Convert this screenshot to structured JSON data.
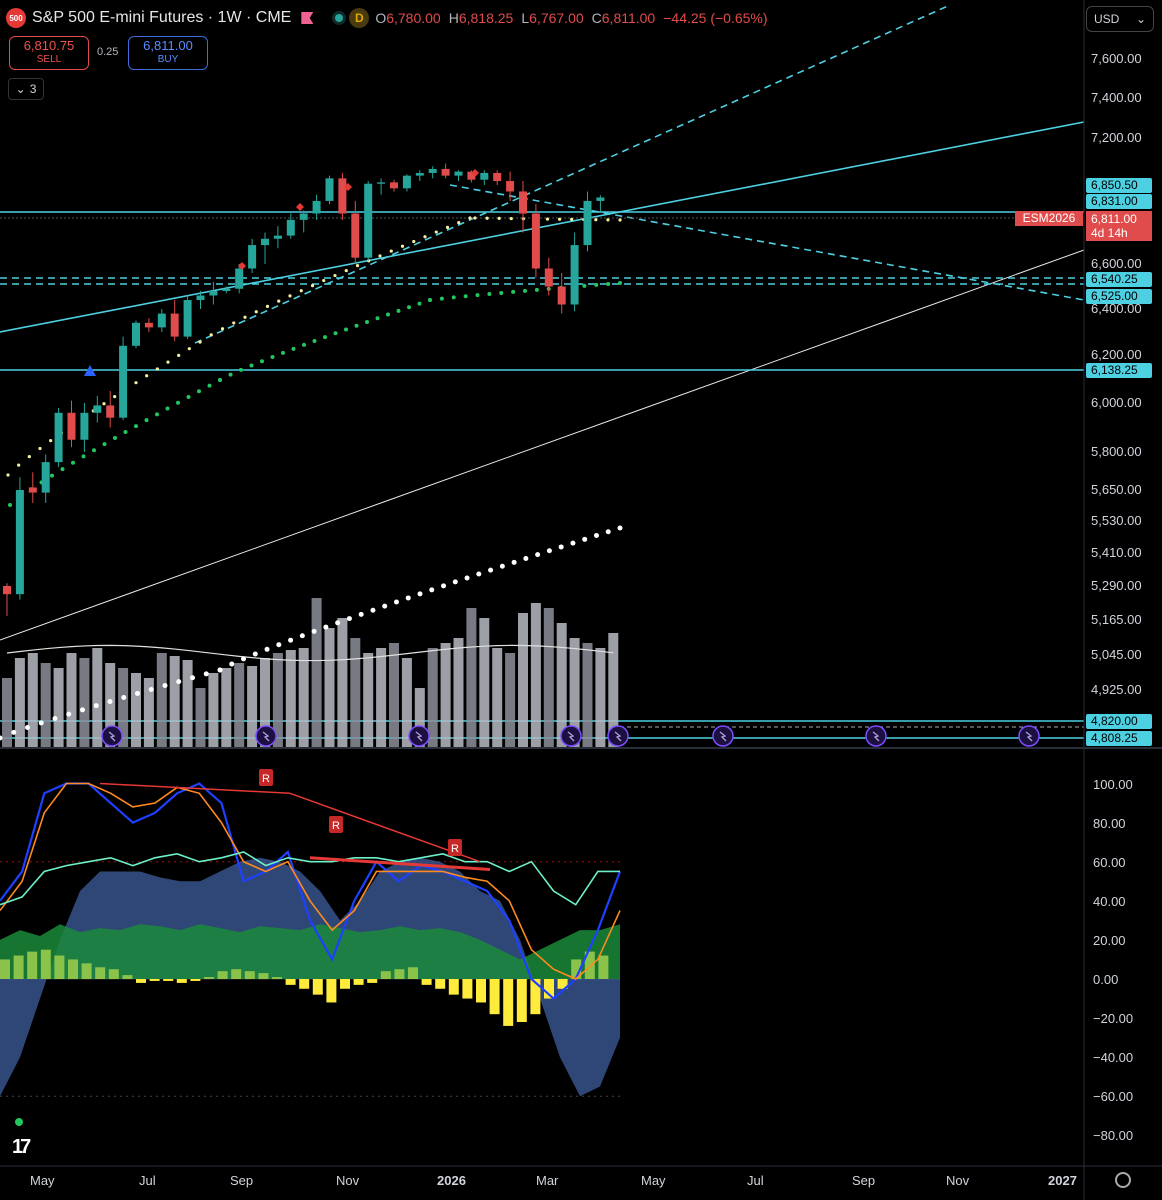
{
  "header": {
    "logo_text": "500",
    "symbol_title": "S&P 500 E-mini Futures · 1W · CME",
    "interval_badge": "D",
    "ohlc": {
      "open_label": "O",
      "open": "6,780.00",
      "high_label": "H",
      "high": "6,818.25",
      "low_label": "L",
      "low": "6,767.00",
      "close_label": "C",
      "close": "6,811.00",
      "change": "−44.25 (−0.65%)"
    },
    "colors": {
      "down": "#e04b4b",
      "up": "#26a69a",
      "accent": "#4dd0e1"
    }
  },
  "trade": {
    "sell_price": "6,810.75",
    "sell_label": "SELL",
    "spread": "0.25",
    "buy_price": "6,811.00",
    "buy_label": "BUY"
  },
  "layers": {
    "icon": "chevron-down-icon",
    "count": "3"
  },
  "currency": {
    "label": "USD",
    "icon": "chevron-down-icon"
  },
  "price_axis": [
    "7,600.00",
    "7,400.00",
    "7,200.00",
    "6,600.00",
    "6,400.00",
    "6,200.00",
    "6,000.00",
    "5,800.00",
    "5,650.00",
    "5,530.00",
    "5,410.00",
    "5,290.00",
    "5,165.00",
    "5,045.00",
    "4,925.00"
  ],
  "price_tags": [
    "6,850.50",
    "6,831.00",
    "6,540.25",
    "6,525.00",
    "6,138.25",
    "4,820.00",
    "4,808.25"
  ],
  "current": {
    "symbol": "ESM2026",
    "price": "6,811.00",
    "countdown": "4d 14h"
  },
  "oscillator_axis": [
    "100.00",
    "80.00",
    "60.00",
    "40.00",
    "20.00",
    "0.00",
    "−20.00",
    "−40.00",
    "−60.00",
    "−80.00"
  ],
  "oscillator_markers": {
    "reversal": "R"
  },
  "time_axis": [
    "May",
    "Jul",
    "Sep",
    "Nov",
    "2026",
    "Mar",
    "May",
    "Jul",
    "Sep",
    "Nov",
    "2027"
  ],
  "chart_data": {
    "type": "candlestick",
    "series": [
      {
        "name": "ESM2026",
        "interval": "1W"
      }
    ],
    "visible_range": [
      "May",
      "2027"
    ],
    "candles_approx": {
      "count": 48,
      "values": [
        [
          5290,
          5300,
          5180,
          5260
        ],
        [
          5260,
          5700,
          5240,
          5650
        ],
        [
          5660,
          5720,
          5600,
          5640
        ],
        [
          5640,
          5790,
          5600,
          5760
        ],
        [
          5760,
          5980,
          5740,
          5960
        ],
        [
          5960,
          6010,
          5820,
          5850
        ],
        [
          5850,
          6000,
          5800,
          5960
        ],
        [
          5960,
          6030,
          5920,
          5990
        ],
        [
          5990,
          6050,
          5900,
          5940
        ],
        [
          5940,
          6280,
          5930,
          6240
        ],
        [
          6240,
          6350,
          6230,
          6340
        ],
        [
          6340,
          6360,
          6300,
          6320
        ],
        [
          6320,
          6400,
          6300,
          6380
        ],
        [
          6380,
          6440,
          6260,
          6280
        ],
        [
          6280,
          6460,
          6270,
          6440
        ],
        [
          6440,
          6480,
          6400,
          6460
        ],
        [
          6460,
          6520,
          6420,
          6480
        ],
        [
          6480,
          6500,
          6470,
          6490
        ],
        [
          6490,
          6600,
          6470,
          6580
        ],
        [
          6580,
          6680,
          6560,
          6660
        ],
        [
          6660,
          6700,
          6600,
          6680
        ],
        [
          6680,
          6720,
          6650,
          6690
        ],
        [
          6690,
          6760,
          6680,
          6740
        ],
        [
          6740,
          6770,
          6700,
          6760
        ],
        [
          6760,
          6820,
          6740,
          6800
        ],
        [
          6800,
          6920,
          6790,
          6900
        ],
        [
          6900,
          6940,
          6740,
          6760
        ],
        [
          6760,
          6800,
          6600,
          6620
        ],
        [
          6620,
          6880,
          6610,
          6860
        ],
        [
          6860,
          6900,
          6820,
          6870
        ],
        [
          6870,
          6890,
          6830,
          6840
        ],
        [
          6840,
          6930,
          6830,
          6920
        ],
        [
          6920,
          6960,
          6880,
          6940
        ],
        [
          6940,
          6990,
          6900,
          6970
        ],
        [
          6970,
          7010,
          6900,
          6920
        ],
        [
          6920,
          6960,
          6880,
          6950
        ],
        [
          6950,
          6960,
          6870,
          6890
        ],
        [
          6890,
          6960,
          6850,
          6940
        ],
        [
          6940,
          6960,
          6850,
          6880
        ],
        [
          6880,
          6950,
          6800,
          6830
        ],
        [
          6830,
          6880,
          6700,
          6760
        ],
        [
          6760,
          6790,
          6540,
          6580
        ],
        [
          6580,
          6620,
          6460,
          6500
        ],
        [
          6500,
          6560,
          6380,
          6420
        ],
        [
          6420,
          6700,
          6390,
          6660
        ],
        [
          6660,
          6830,
          6640,
          6800
        ],
        [
          6800,
          6818,
          6767,
          6811
        ]
      ]
    },
    "oscillator_range": [
      -80,
      100
    ]
  }
}
